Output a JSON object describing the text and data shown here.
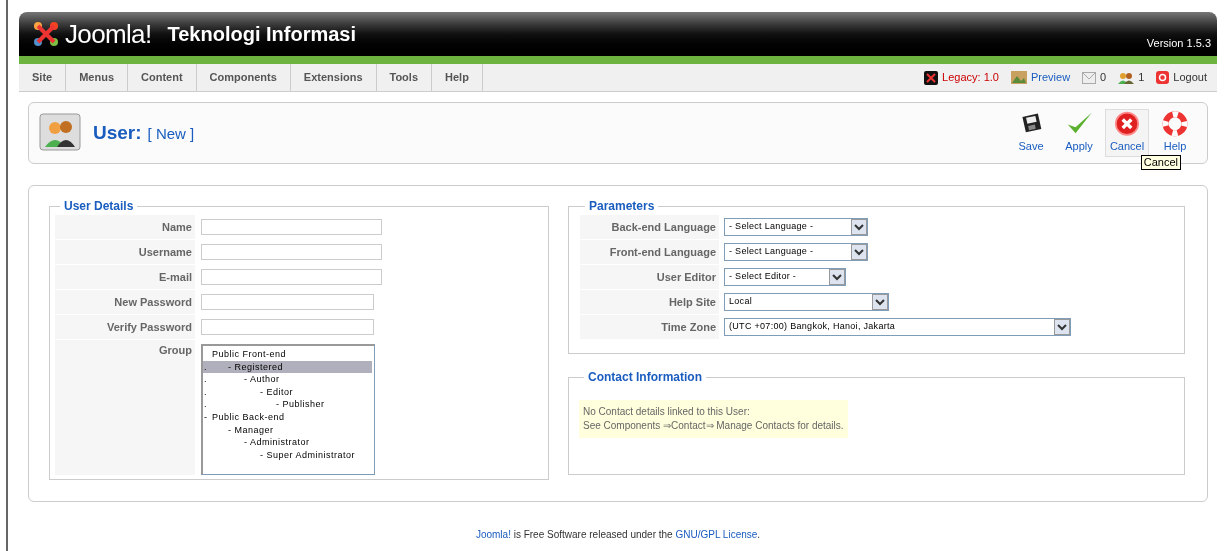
{
  "header": {
    "title": "Teknologi Informasi",
    "logo_text": "Joomla!",
    "version": "Version 1.5.3"
  },
  "menu": [
    {
      "label": "Site"
    },
    {
      "label": "Menus"
    },
    {
      "label": "Content"
    },
    {
      "label": "Components"
    },
    {
      "label": "Extensions"
    },
    {
      "label": "Tools"
    },
    {
      "label": "Help"
    }
  ],
  "status": [
    {
      "kind": "legacy",
      "text": "Legacy: 1.0"
    },
    {
      "kind": "preview",
      "text": "Preview"
    },
    {
      "kind": "messages",
      "text": "0"
    },
    {
      "kind": "users",
      "text": "1"
    },
    {
      "kind": "logout",
      "text": "Logout"
    }
  ],
  "page": {
    "title": "User:",
    "subtitle": "[ New ]"
  },
  "toolbar": [
    {
      "kind": "save",
      "label": "Save",
      "hovered": false
    },
    {
      "kind": "apply",
      "label": "Apply",
      "hovered": false
    },
    {
      "kind": "cancel",
      "label": "Cancel",
      "hovered": true
    },
    {
      "kind": "help",
      "label": "Help",
      "hovered": false
    }
  ],
  "tooltip": "Cancel",
  "user_details": {
    "legend": "User Details",
    "fields": [
      {
        "label": "Name"
      },
      {
        "label": "Username"
      },
      {
        "label": "E-mail"
      },
      {
        "label": "New Password"
      },
      {
        "label": "Verify Password"
      }
    ],
    "group": {
      "label": "Group",
      "options": [
        {
          "label": "Public Front-end",
          "selected": false,
          "children": [
            {
              "marker": ".",
              "label": "- Registered",
              "selected": true,
              "children": [
                {
                  "marker": ".",
                  "label": "- Author",
                  "selected": false,
                  "children": [
                    {
                      "marker": ".",
                      "label": "- Editor",
                      "selected": false,
                      "children": [
                        {
                          "marker": ".",
                          "label": "- Publisher",
                          "selected": false
                        }
                      ]
                    }
                  ]
                }
              ]
            }
          ]
        },
        {
          "marker": "-",
          "label": "Public Back-end",
          "selected": false,
          "children": [
            {
              "label": "- Manager",
              "selected": false,
              "children": [
                {
                  "label": "- Administrator",
                  "selected": false,
                  "children": [
                    {
                      "label": "- Super Administrator",
                      "selected": false
                    }
                  ]
                }
              ]
            }
          ]
        }
      ]
    }
  },
  "parameters": {
    "legend": "Parameters",
    "fields": [
      {
        "label": "Back-end Language",
        "value": "- Select Language -"
      },
      {
        "label": "Front-end Language",
        "value": "- Select Language -"
      },
      {
        "label": "User Editor",
        "value": "- Select Editor -"
      },
      {
        "label": "Help Site",
        "value": "Local"
      },
      {
        "label": "Time Zone",
        "value": "(UTC +07:00) Bangkok, Hanoi, Jakarta"
      }
    ]
  },
  "contact": {
    "legend": "Contact Information",
    "lines": [
      "No Contact details linked to this User:",
      "See Components ⇒Contact⇒ Manage Contacts for details."
    ]
  },
  "footer": [
    {
      "kind": "link",
      "text": "Joomla!"
    },
    {
      "kind": "text",
      "text": " is Free Software released under the "
    },
    {
      "kind": "link",
      "text": "GNU/GPL License"
    },
    {
      "kind": "text",
      "text": "."
    }
  ]
}
